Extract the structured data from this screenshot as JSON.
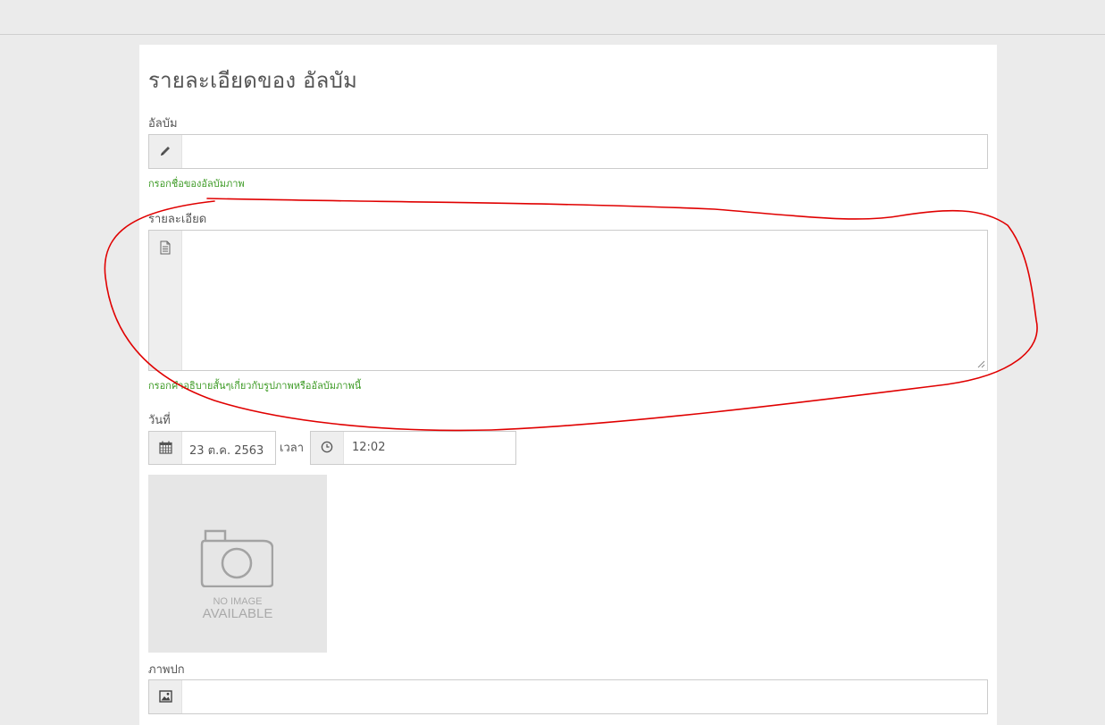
{
  "page_title": "รายละเอียดของ อัลบัม",
  "album": {
    "label": "อัลบัม",
    "value": "",
    "hint": "กรอกชื่อของอัลบัมภาพ",
    "icon": "pencil-icon"
  },
  "description": {
    "label": "รายละเอียด",
    "value": "",
    "hint": "กรอกคำอธิบายสั้นๆเกี่ยวกับรูปภาพหรืออัลบัมภาพนี้",
    "icon": "document-icon"
  },
  "date": {
    "label": "วันที่",
    "value": "23 ต.ค. 2563",
    "icon": "calendar-icon"
  },
  "time": {
    "label": "เวลา",
    "value": "12:02",
    "icon": "clock-icon"
  },
  "placeholder_image": {
    "line1": "NO IMAGE",
    "line2": "AVAILABLE"
  },
  "cover": {
    "label": "ภาพปก",
    "value": "",
    "icon": "image-icon"
  },
  "annotation": {
    "color": "#e00000"
  }
}
